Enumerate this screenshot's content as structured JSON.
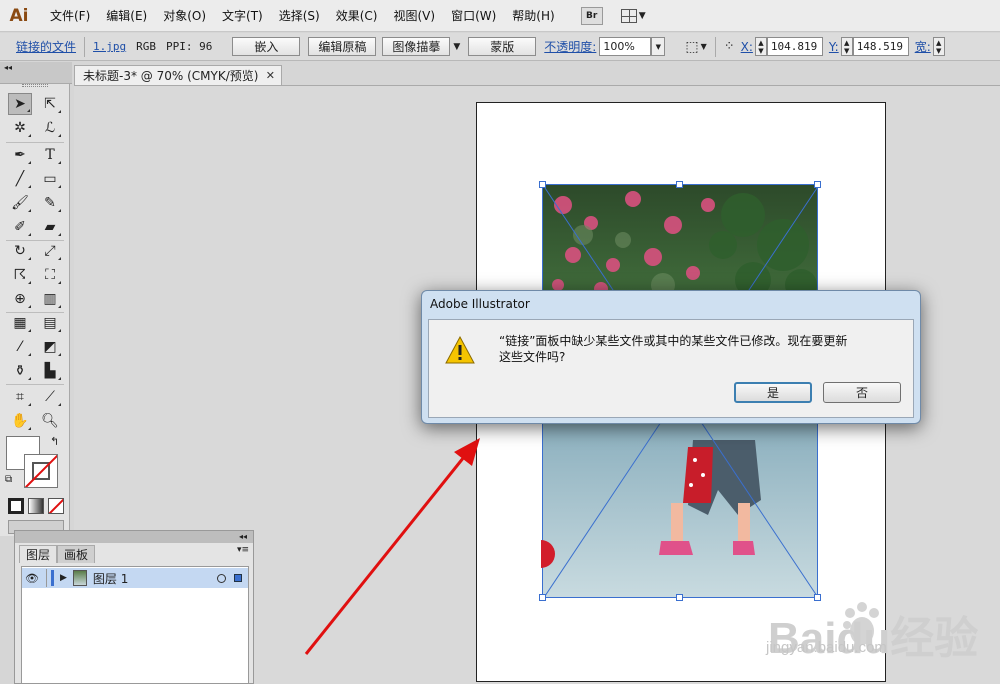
{
  "app": {
    "logo": "Ai"
  },
  "menu": {
    "items": [
      "文件(F)",
      "编辑(E)",
      "对象(O)",
      "文字(T)",
      "选择(S)",
      "效果(C)",
      "视图(V)",
      "窗口(W)",
      "帮助(H)"
    ],
    "bridge_label": "Br"
  },
  "control_bar": {
    "linked_file_label": "链接的文件",
    "file_name": "1.jpg",
    "color_mode": "RGB",
    "ppi_label": "PPI: 96",
    "embed_button": "嵌入",
    "edit_original_button": "编辑原稿",
    "image_trace_button": "图像描摹",
    "mask_button": "蒙版",
    "opacity_label": "不透明度:",
    "opacity_value": "100%",
    "x_label": "X:",
    "x_value": "104.819",
    "y_label": "Y:",
    "y_value": "148.519",
    "width_label": "宽:"
  },
  "document": {
    "tab_title": "未标题-3* @ 70% (CMYK/预览)",
    "close_glyph": "✕"
  },
  "dialog": {
    "title": "Adobe Illustrator",
    "message_line1": "“链接”面板中缺少某些文件或其中的某些文件已修改。现在要更新",
    "message_line2": "这些文件吗?",
    "yes_button": "是",
    "no_button": "否",
    "icon": "warning-icon"
  },
  "layers_panel": {
    "tabs": [
      "图层",
      "画板"
    ],
    "collapse_glyph": "◂◂",
    "menu_glyph": "▾≡",
    "layer_name": "图层 1"
  },
  "watermark": {
    "text": "Baidu经验",
    "url": "jingyan.baidu.com"
  },
  "colors": {
    "accent": "#3c7fb1",
    "selection_blue": "#3a6fcf",
    "arrow_red": "#e01010",
    "warning_yellow": "#f5c400"
  }
}
